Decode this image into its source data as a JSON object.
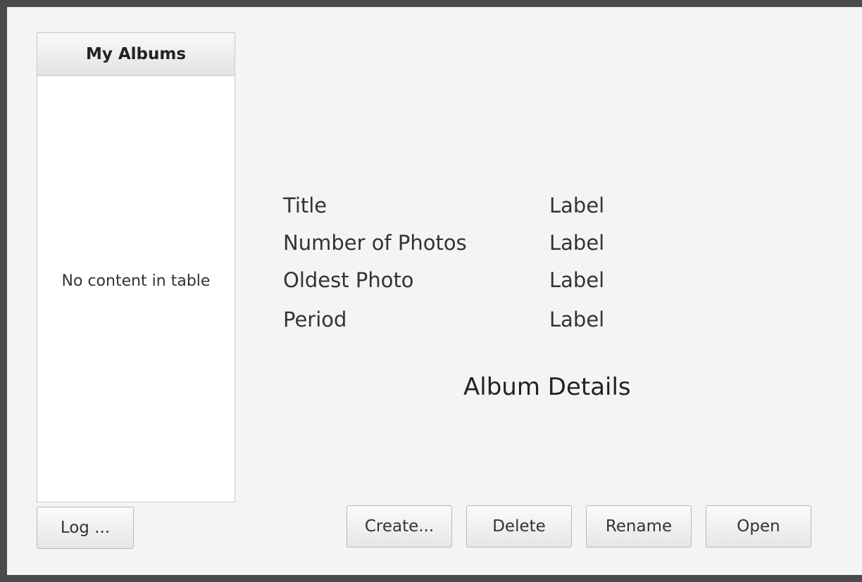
{
  "albums_table": {
    "header": "My Albums",
    "empty_message": "No content in table"
  },
  "details": {
    "rows": [
      {
        "label": "Title",
        "value": "Label"
      },
      {
        "label": "Number of Photos",
        "value": "Label"
      },
      {
        "label": "Oldest Photo",
        "value": "Label"
      },
      {
        "label": "Period",
        "value": "Label"
      }
    ],
    "section_title": "Album Details"
  },
  "buttons": {
    "log": "Log ...",
    "create": "Create...",
    "delete": "Delete",
    "rename": "Rename",
    "open": "Open"
  }
}
